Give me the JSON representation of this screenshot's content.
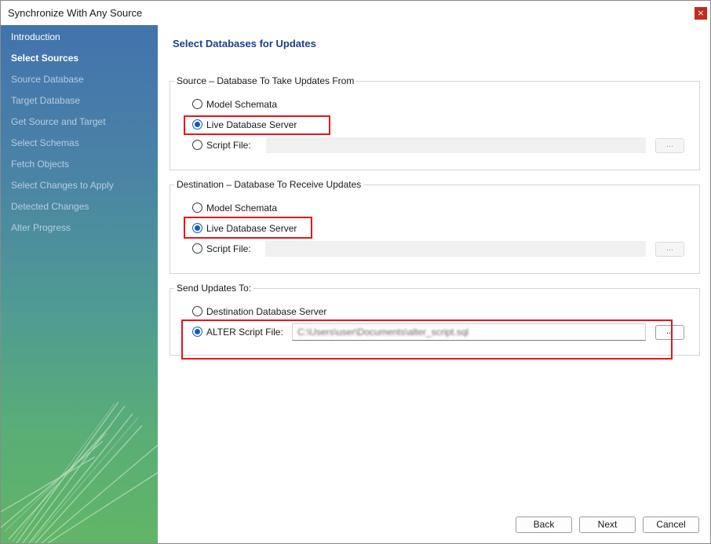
{
  "window": {
    "title": "Synchronize With Any Source",
    "close_label": "×"
  },
  "sidebar": {
    "items": [
      {
        "label": "Introduction",
        "state": "done"
      },
      {
        "label": "Select Sources",
        "state": "active"
      },
      {
        "label": "Source Database",
        "state": "pending"
      },
      {
        "label": "Target Database",
        "state": "pending"
      },
      {
        "label": "Get Source and Target",
        "state": "pending"
      },
      {
        "label": "Select Schemas",
        "state": "pending"
      },
      {
        "label": "Fetch Objects",
        "state": "pending"
      },
      {
        "label": "Select Changes to Apply",
        "state": "pending"
      },
      {
        "label": "Detected Changes",
        "state": "pending"
      },
      {
        "label": "Alter Progress",
        "state": "pending"
      }
    ]
  },
  "main": {
    "title": "Select Databases for Updates",
    "source_group": {
      "legend": "Source – Database To Take Updates From",
      "options": [
        "Model Schemata",
        "Live Database Server",
        "Script File:"
      ],
      "selected": "Live Database Server",
      "browse_label": "..."
    },
    "destination_group": {
      "legend": "Destination – Database To Receive Updates",
      "options": [
        "Model Schemata",
        "Live Database Server",
        "Script File:"
      ],
      "selected": "Live Database Server",
      "browse_label": "..."
    },
    "send_group": {
      "legend": "Send Updates To:",
      "options": [
        "Destination Database Server",
        "ALTER Script File:"
      ],
      "selected": "ALTER Script File:",
      "script_path": "C:\\Users\\user\\Documents\\alter_script.sql",
      "browse_label": "..."
    }
  },
  "buttons": {
    "back": "Back",
    "next": "Next",
    "cancel": "Cancel"
  },
  "colors": {
    "highlight": "#e8141b",
    "title": "#1b3f8b",
    "radio_selected": "#0f5cc0"
  }
}
